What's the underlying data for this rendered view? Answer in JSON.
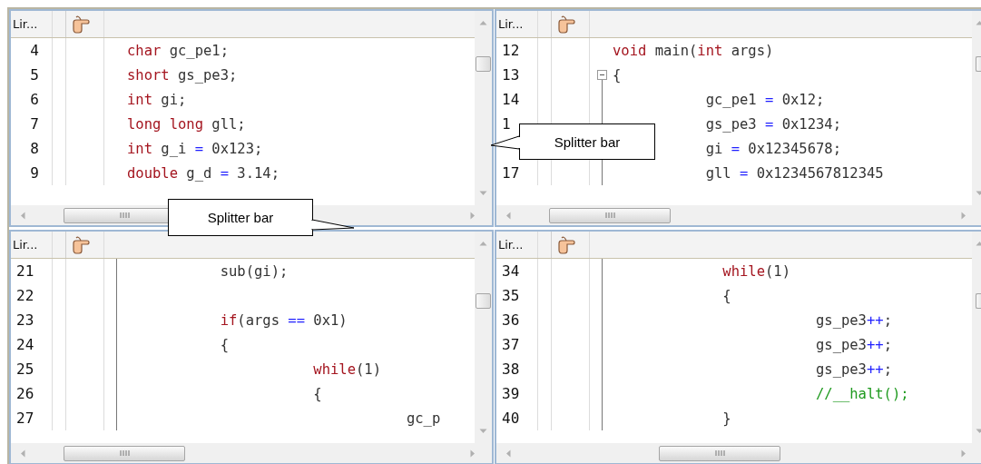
{
  "panes": [
    {
      "column_header": "Lir...",
      "lines": [
        {
          "number": "4",
          "tokens": [
            {
              "kind": "keyword",
              "text": "char"
            },
            {
              "kind": "plain",
              "text": " gc_pe1;"
            }
          ]
        },
        {
          "number": "5",
          "tokens": [
            {
              "kind": "keyword",
              "text": "short"
            },
            {
              "kind": "plain",
              "text": " gs_pe3;"
            }
          ]
        },
        {
          "number": "6",
          "tokens": [
            {
              "kind": "keyword",
              "text": "int"
            },
            {
              "kind": "plain",
              "text": " gi;"
            }
          ]
        },
        {
          "number": "7",
          "tokens": [
            {
              "kind": "keyword",
              "text": "long long"
            },
            {
              "kind": "plain",
              "text": " gll;"
            }
          ]
        },
        {
          "number": "8",
          "tokens": [
            {
              "kind": "keyword",
              "text": "int"
            },
            {
              "kind": "plain",
              "text": " g_i "
            },
            {
              "kind": "operator",
              "text": "="
            },
            {
              "kind": "plain",
              "text": " 0x123;"
            }
          ]
        },
        {
          "number": "9",
          "tokens": [
            {
              "kind": "keyword",
              "text": "double"
            },
            {
              "kind": "plain",
              "text": " g_d "
            },
            {
              "kind": "operator",
              "text": "="
            },
            {
              "kind": "plain",
              "text": " 3.14;"
            }
          ]
        }
      ]
    },
    {
      "column_header": "Lir...",
      "lines": [
        {
          "number": "12",
          "tokens": [
            {
              "kind": "keyword",
              "text": "void"
            },
            {
              "kind": "plain",
              "text": " main("
            },
            {
              "kind": "keyword",
              "text": "int"
            },
            {
              "kind": "plain",
              "text": " args)"
            }
          ]
        },
        {
          "number": "13",
          "fold_start": true,
          "tokens": [
            {
              "kind": "plain",
              "text": "{"
            }
          ]
        },
        {
          "number": "14",
          "fold_line": true,
          "tokens": [
            {
              "kind": "plain",
              "text": "           gc_pe1 "
            },
            {
              "kind": "operator",
              "text": "="
            },
            {
              "kind": "plain",
              "text": " 0x12;"
            }
          ]
        },
        {
          "number": "1",
          "fold_line": true,
          "tokens": [
            {
              "kind": "plain",
              "text": "           gs_pe3 "
            },
            {
              "kind": "operator",
              "text": "="
            },
            {
              "kind": "plain",
              "text": " 0x1234;"
            }
          ]
        },
        {
          "fold_line": true,
          "tokens": [
            {
              "kind": "plain",
              "text": "           gi "
            },
            {
              "kind": "operator",
              "text": "="
            },
            {
              "kind": "plain",
              "text": " 0x12345678;"
            }
          ]
        },
        {
          "number": "17",
          "fold_line": true,
          "tokens": [
            {
              "kind": "plain",
              "text": "           gll "
            },
            {
              "kind": "operator",
              "text": "="
            },
            {
              "kind": "plain",
              "text": " 0x1234567812345"
            }
          ]
        }
      ]
    },
    {
      "column_header": "Lir...",
      "lines": [
        {
          "number": "21",
          "fold_line": true,
          "tokens": [
            {
              "kind": "plain",
              "text": "           sub(gi);"
            }
          ]
        },
        {
          "number": "22",
          "fold_line": true
        },
        {
          "number": "23",
          "fold_line": true,
          "tokens": [
            {
              "kind": "keyword",
              "text": "           if"
            },
            {
              "kind": "plain",
              "text": "(args "
            },
            {
              "kind": "operator",
              "text": "=="
            },
            {
              "kind": "plain",
              "text": " 0x1)"
            }
          ]
        },
        {
          "number": "24",
          "fold_line": true,
          "tokens": [
            {
              "kind": "plain",
              "text": "           {"
            }
          ]
        },
        {
          "number": "25",
          "fold_line": true,
          "tokens": [
            {
              "kind": "keyword",
              "text": "                      while"
            },
            {
              "kind": "plain",
              "text": "(1)"
            }
          ]
        },
        {
          "number": "26",
          "fold_line": true,
          "tokens": [
            {
              "kind": "plain",
              "text": "                      {"
            }
          ]
        },
        {
          "number": "27",
          "fold_line": true,
          "tokens": [
            {
              "kind": "plain",
              "text": "                                 gc_p"
            }
          ]
        }
      ]
    },
    {
      "column_header": "Lir...",
      "lines": [
        {
          "number": "34",
          "fold_line": true,
          "tokens": [
            {
              "kind": "keyword",
              "text": "             while"
            },
            {
              "kind": "plain",
              "text": "(1)"
            }
          ]
        },
        {
          "number": "35",
          "fold_line": true,
          "tokens": [
            {
              "kind": "plain",
              "text": "             {"
            }
          ]
        },
        {
          "number": "36",
          "fold_line": true,
          "tokens": [
            {
              "kind": "plain",
              "text": "                        gs_pe3"
            },
            {
              "kind": "operator",
              "text": "++"
            },
            {
              "kind": "plain",
              "text": ";"
            }
          ]
        },
        {
          "number": "37",
          "fold_line": true,
          "tokens": [
            {
              "kind": "plain",
              "text": "                        gs_pe3"
            },
            {
              "kind": "operator",
              "text": "++"
            },
            {
              "kind": "plain",
              "text": ";"
            }
          ]
        },
        {
          "number": "38",
          "fold_line": true,
          "tokens": [
            {
              "kind": "plain",
              "text": "                        gs_pe3"
            },
            {
              "kind": "operator",
              "text": "++"
            },
            {
              "kind": "plain",
              "text": ";"
            }
          ]
        },
        {
          "number": "39",
          "fold_line": true,
          "tokens": [
            {
              "kind": "comment",
              "text": "                        //__halt();"
            }
          ]
        },
        {
          "number": "40",
          "fold_line": true,
          "tokens": [
            {
              "kind": "plain",
              "text": "             }"
            }
          ]
        }
      ]
    }
  ],
  "callouts": [
    {
      "text": "Splitter bar"
    },
    {
      "text": "Splitter bar"
    }
  ]
}
